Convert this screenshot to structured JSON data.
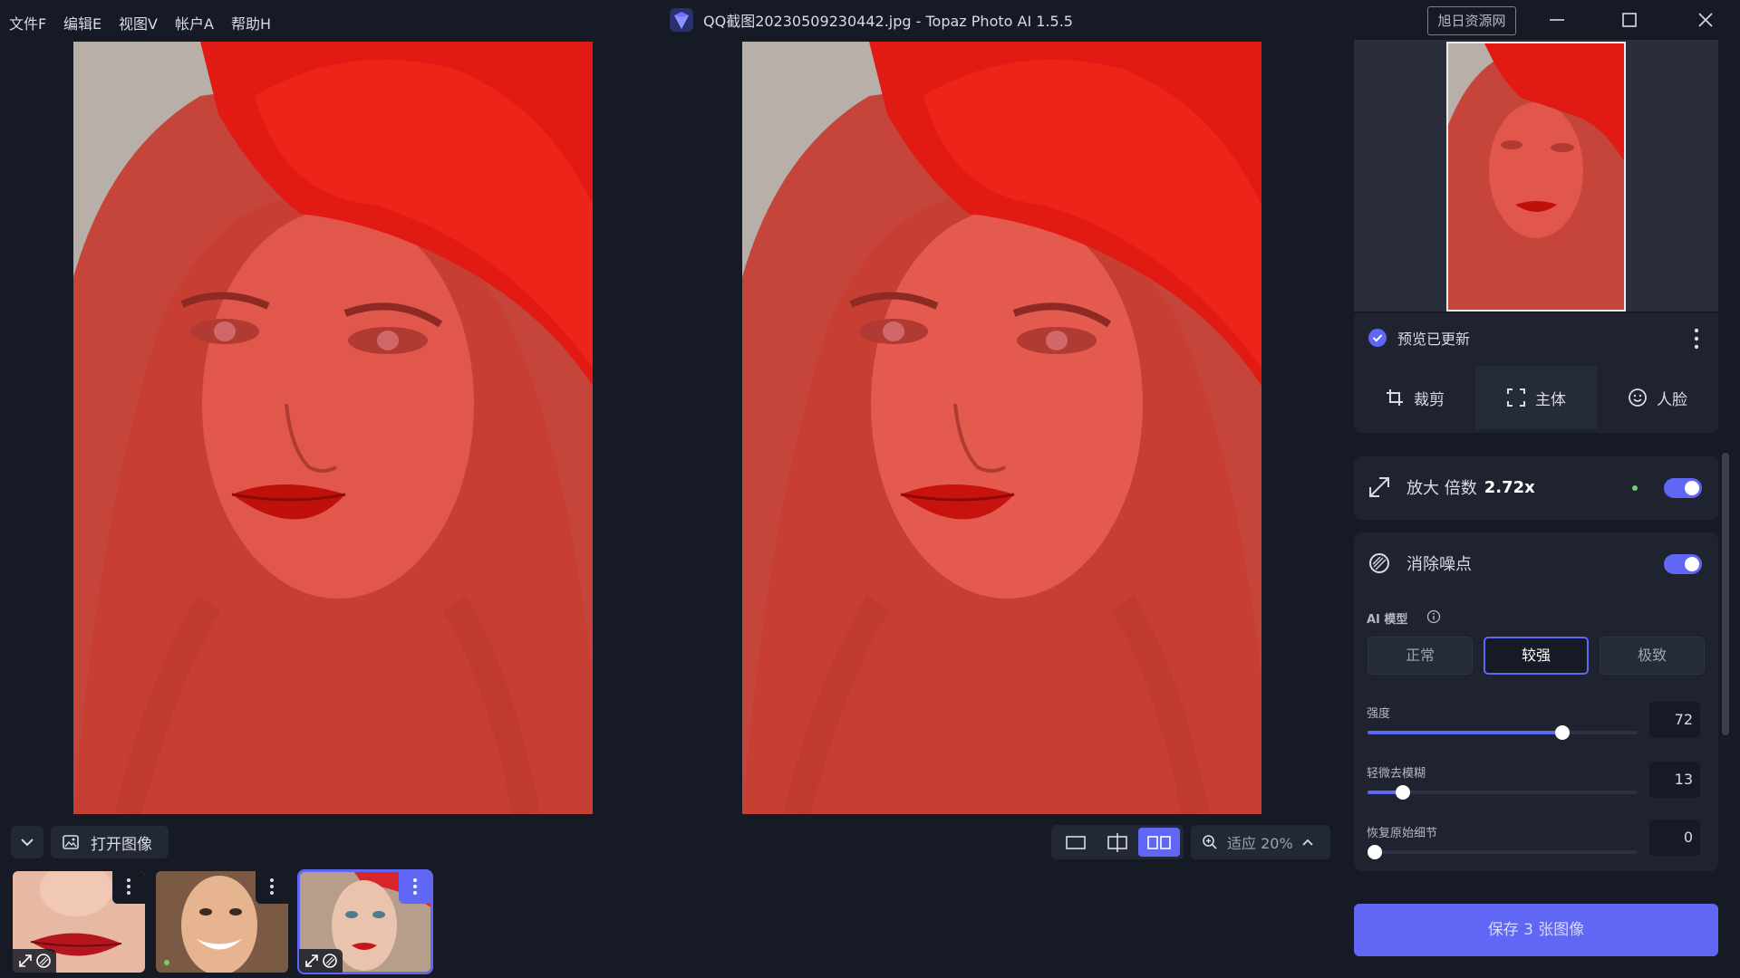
{
  "menu": [
    "文件F",
    "编辑E",
    "视图V",
    "帐户A",
    "帮助H"
  ],
  "window_title": "QQ截图20230509230442.jpg - Topaz Photo AI 1.5.5",
  "watermark": "旭日资源网",
  "toolbar": {
    "open_image": "打开图像",
    "zoom_label": "适应 20%"
  },
  "panel": {
    "preview_status": "预览已更新",
    "tabs": [
      "裁剪",
      "主体",
      "人脸"
    ],
    "upscale": {
      "label": "放大 倍数",
      "value": "2.72x"
    },
    "denoise": {
      "label": "消除噪点",
      "ai_model_label": "AI 模型",
      "modes": [
        "正常",
        "较强",
        "极致"
      ],
      "selected_mode": "较强"
    },
    "sliders": [
      {
        "label": "强度",
        "value": 72
      },
      {
        "label": "轻微去模糊",
        "value": 13
      },
      {
        "label": "恢复原始细节",
        "value": 0
      }
    ],
    "save_button": "保存 3 张图像"
  },
  "colors": {
    "accent": "#6067f5",
    "background": "#161a25",
    "panel": "#1f2330"
  }
}
